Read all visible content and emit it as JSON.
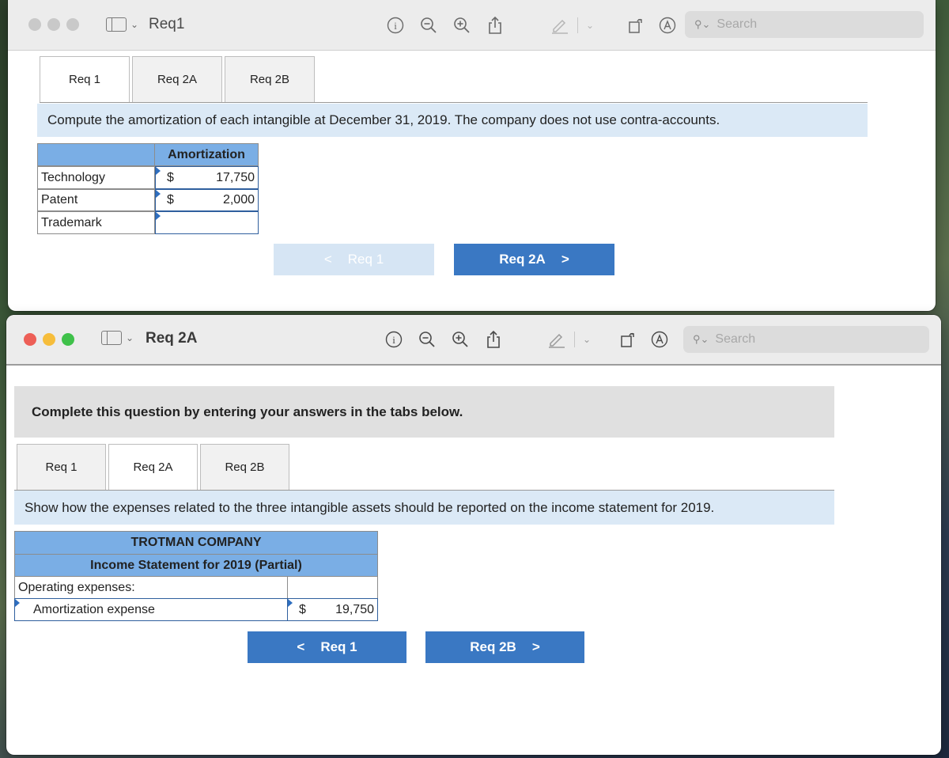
{
  "window1": {
    "title": "Req1",
    "search_placeholder": "Search",
    "tabs": [
      "Req 1",
      "Req 2A",
      "Req 2B"
    ],
    "instruction": "Compute the amortization of each intangible at December 31, 2019. The company does not use contra-accounts.",
    "table": {
      "header": "Amortization",
      "rows": [
        {
          "label": "Technology",
          "currency": "$",
          "value": "17,750"
        },
        {
          "label": "Patent",
          "currency": "$",
          "value": "2,000"
        },
        {
          "label": "Trademark",
          "currency": "",
          "value": ""
        }
      ]
    },
    "prev_button": "Req 1",
    "next_button": "Req 2A",
    "prev_arrow": "<",
    "next_arrow": ">"
  },
  "window2": {
    "title": "Req 2A",
    "search_placeholder": "Search",
    "banner": "Complete this question by entering your answers in the tabs below.",
    "tabs": [
      "Req 1",
      "Req 2A",
      "Req 2B"
    ],
    "instruction": "Show how the expenses related to the three intangible assets should be reported on the income statement for 2019.",
    "statement": {
      "company": "TROTMAN COMPANY",
      "title": "Income Statement for 2019 (Partial)",
      "section": "Operating expenses:",
      "line_label": "Amortization expense",
      "currency": "$",
      "value": "19,750"
    },
    "prev_button": "Req 1",
    "next_button": "Req 2B",
    "prev_arrow": "<",
    "next_arrow": ">"
  },
  "colors": {
    "accent_blue": "#3a78c3",
    "header_blue": "#7aaee5",
    "instruction_bg": "#dbe9f6",
    "close": "#ed5f57",
    "minimize": "#f6bd3b",
    "zoom": "#3fc14a"
  }
}
